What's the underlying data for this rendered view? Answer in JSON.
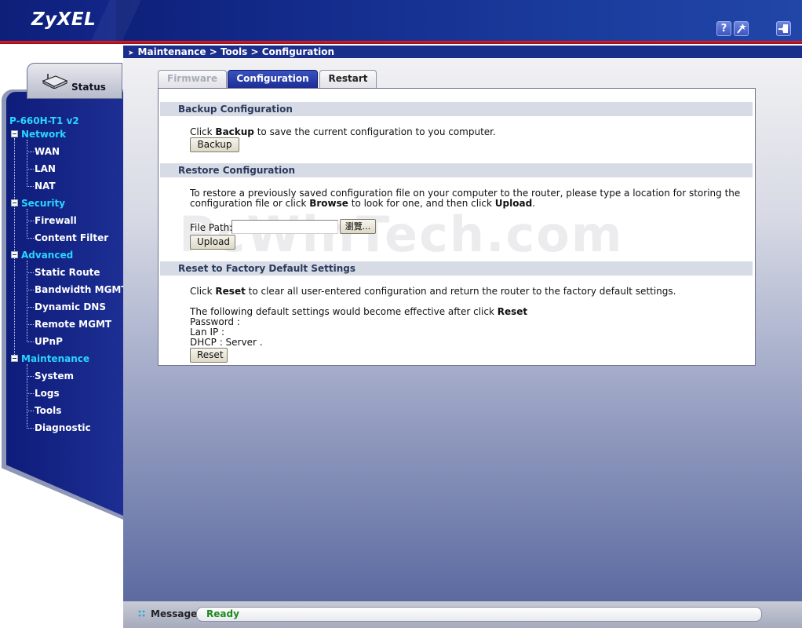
{
  "header": {
    "logo": "ZyXEL",
    "help_icon": "question-icon",
    "wizard_icon": "wizard-icon",
    "logout_icon": "logout-icon"
  },
  "breadcrumb": "Maintenance > Tools > Configuration",
  "sidebar": {
    "status_tab": "Status",
    "device_name": "P-660H-T1 v2",
    "sections": [
      {
        "label": "Network",
        "items": [
          "WAN",
          "LAN",
          "NAT"
        ]
      },
      {
        "label": "Security",
        "items": [
          "Firewall",
          "Content Filter"
        ]
      },
      {
        "label": "Advanced",
        "items": [
          "Static Route",
          "Bandwidth MGMT",
          "Dynamic DNS",
          "Remote MGMT",
          "UPnP"
        ]
      },
      {
        "label": "Maintenance",
        "items": [
          "System",
          "Logs",
          "Tools",
          "Diagnostic"
        ]
      }
    ]
  },
  "tabs": {
    "firmware": "Firmware",
    "configuration": "Configuration",
    "restart": "Restart"
  },
  "backup": {
    "title": "Backup Configuration",
    "text_pre": "Click ",
    "text_bold": "Backup",
    "text_post": " to save the current configuration to you computer.",
    "button": "Backup"
  },
  "restore": {
    "title": "Restore Configuration",
    "line1": "To restore a previously saved configuration file on your computer to the router, please type a location for storing the",
    "line2_pre": "configuration file or click ",
    "line2_b1": "Browse",
    "line2_mid": " to look for one, and then click ",
    "line2_b2": "Upload",
    "line2_post": ".",
    "file_path_label": "File Path:",
    "file_path_value": "",
    "browse_button": "瀏覽...",
    "upload_button": "Upload"
  },
  "reset": {
    "title": "Reset to Factory Default Settings",
    "line1_pre": "Click ",
    "line1_bold": "Reset",
    "line1_post": " to clear all user-entered configuration and return the router to the factory default settings.",
    "line2_pre": "The following default settings would become effective after click ",
    "line2_bold": "Reset",
    "password": "Password :",
    "lan_ip": "Lan IP :",
    "dhcp": "DHCP : Server .",
    "button": "Reset"
  },
  "watermark": "PcWinTech.com",
  "message": {
    "label": "Message",
    "status": "Ready"
  }
}
